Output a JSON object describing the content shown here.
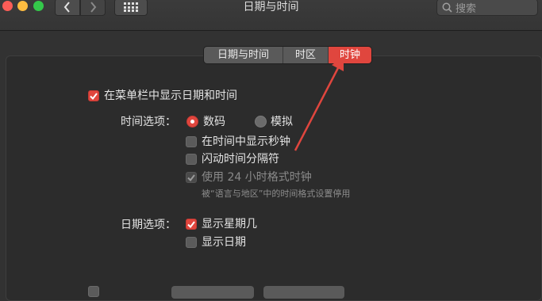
{
  "window": {
    "title": "日期与时间"
  },
  "toolbar": {
    "search_placeholder": "搜索"
  },
  "tabs": [
    {
      "label": "日期与时间",
      "selected": false
    },
    {
      "label": "时区",
      "selected": false
    },
    {
      "label": "时钟",
      "selected": true
    }
  ],
  "clock": {
    "show_in_menubar": {
      "label": "在菜单栏中显示日期和时间",
      "checked": true
    },
    "time_options": {
      "label": "时间选项：",
      "digital": {
        "label": "数码",
        "selected": true
      },
      "analog": {
        "label": "模拟",
        "selected": false
      },
      "show_seconds": {
        "label": "在时间中显示秒钟",
        "checked": false
      },
      "flash_separators": {
        "label": "闪动时间分隔符",
        "checked": false
      },
      "use_24h": {
        "label": "使用 24 小时格式时钟",
        "checked": true,
        "enabled": false
      },
      "use_24h_note": "被“语言与地区”中的时间格式设置停用"
    },
    "date_options": {
      "label": "日期选项：",
      "show_weekday": {
        "label": "显示星期几",
        "checked": true
      },
      "show_date": {
        "label": "显示日期",
        "checked": false
      }
    }
  },
  "colors": {
    "accent": "#e0463e",
    "annotation_arrow": "#e0463e"
  }
}
